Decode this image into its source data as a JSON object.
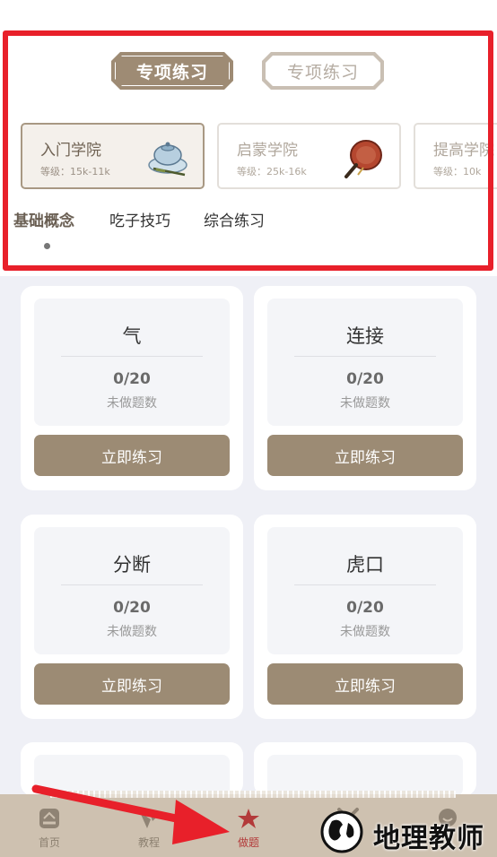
{
  "mode_tabs": [
    {
      "label": "专项练习",
      "active": true
    },
    {
      "label": "专项练习",
      "active": false
    }
  ],
  "academies": [
    {
      "name": "入门学院",
      "level": "等级：15k-11k",
      "icon": "teapot-icon",
      "active": true
    },
    {
      "name": "启蒙学院",
      "level": "等级：25k-16k",
      "icon": "fan-icon",
      "active": false
    },
    {
      "name": "提高学院",
      "level": "等级：10k",
      "icon": "",
      "active": false
    }
  ],
  "categories": [
    {
      "label": "基础概念",
      "active": true
    },
    {
      "label": "吃子技巧",
      "active": false
    },
    {
      "label": "综合练习",
      "active": false
    }
  ],
  "topics": [
    {
      "title": "气",
      "count": "0/20",
      "sub": "未做题数",
      "button": "立即练习"
    },
    {
      "title": "连接",
      "count": "0/20",
      "sub": "未做题数",
      "button": "立即练习"
    },
    {
      "title": "分断",
      "count": "0/20",
      "sub": "未做题数",
      "button": "立即练习"
    },
    {
      "title": "虎口",
      "count": "0/20",
      "sub": "未做题数",
      "button": "立即练习"
    }
  ],
  "bottom_nav": [
    {
      "label": "首页",
      "icon": "home-icon",
      "active": false
    },
    {
      "label": "教程",
      "icon": "tutorial-icon",
      "active": false
    },
    {
      "label": "做题",
      "icon": "star-icon",
      "active": true
    },
    {
      "label": "",
      "icon": "sword-icon",
      "active": false
    },
    {
      "label": "",
      "icon": "profile-icon",
      "active": false
    }
  ],
  "watermark": {
    "text": "地理教师"
  },
  "colors": {
    "accent": "#9c8b74",
    "highlight": "#e8202a",
    "nav_bg": "#cec1b0",
    "active_nav": "#b33a3a",
    "page_bg": "#eff0f6"
  }
}
